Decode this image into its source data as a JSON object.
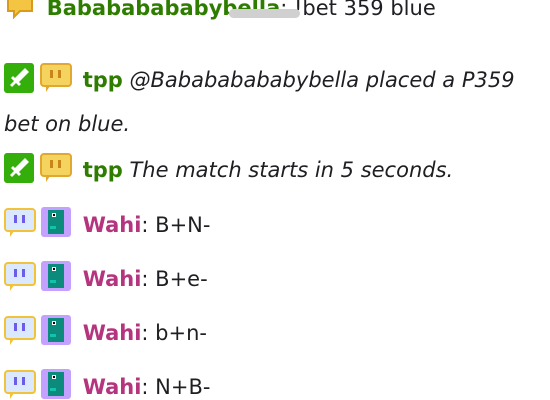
{
  "colors": {
    "mod_badge": "#34ae0a",
    "bot_name": "#2e7d00",
    "wahi_name": "#b5347e",
    "scroll_handle": "#d0d0d0"
  },
  "icons": {
    "mod": "sword-icon",
    "bot": "twitch-chat-bubble-icon",
    "wahi_badge1": "twitch-chat-bubble-icon",
    "wahi_badge2": "pixel-dinosaur-icon"
  },
  "messages": [
    {
      "id": "m0",
      "user": "Babababababybella",
      "separator": ":",
      "text": " !bet 359 blue"
    },
    {
      "id": "m1",
      "user": "tpp",
      "text": "@Babababababybella placed a P359 bet on blue."
    },
    {
      "id": "m2",
      "user": "tpp",
      "text": "The match starts in 5 seconds."
    },
    {
      "id": "m3",
      "user": "Wahi",
      "separator": ":",
      "text": " B+N-"
    },
    {
      "id": "m4",
      "user": "Wahi",
      "separator": ":",
      "text": " B+e-"
    },
    {
      "id": "m5",
      "user": "Wahi",
      "separator": ":",
      "text": " b+n-"
    },
    {
      "id": "m6",
      "user": "Wahi",
      "separator": ":",
      "text": " N+B-"
    }
  ]
}
